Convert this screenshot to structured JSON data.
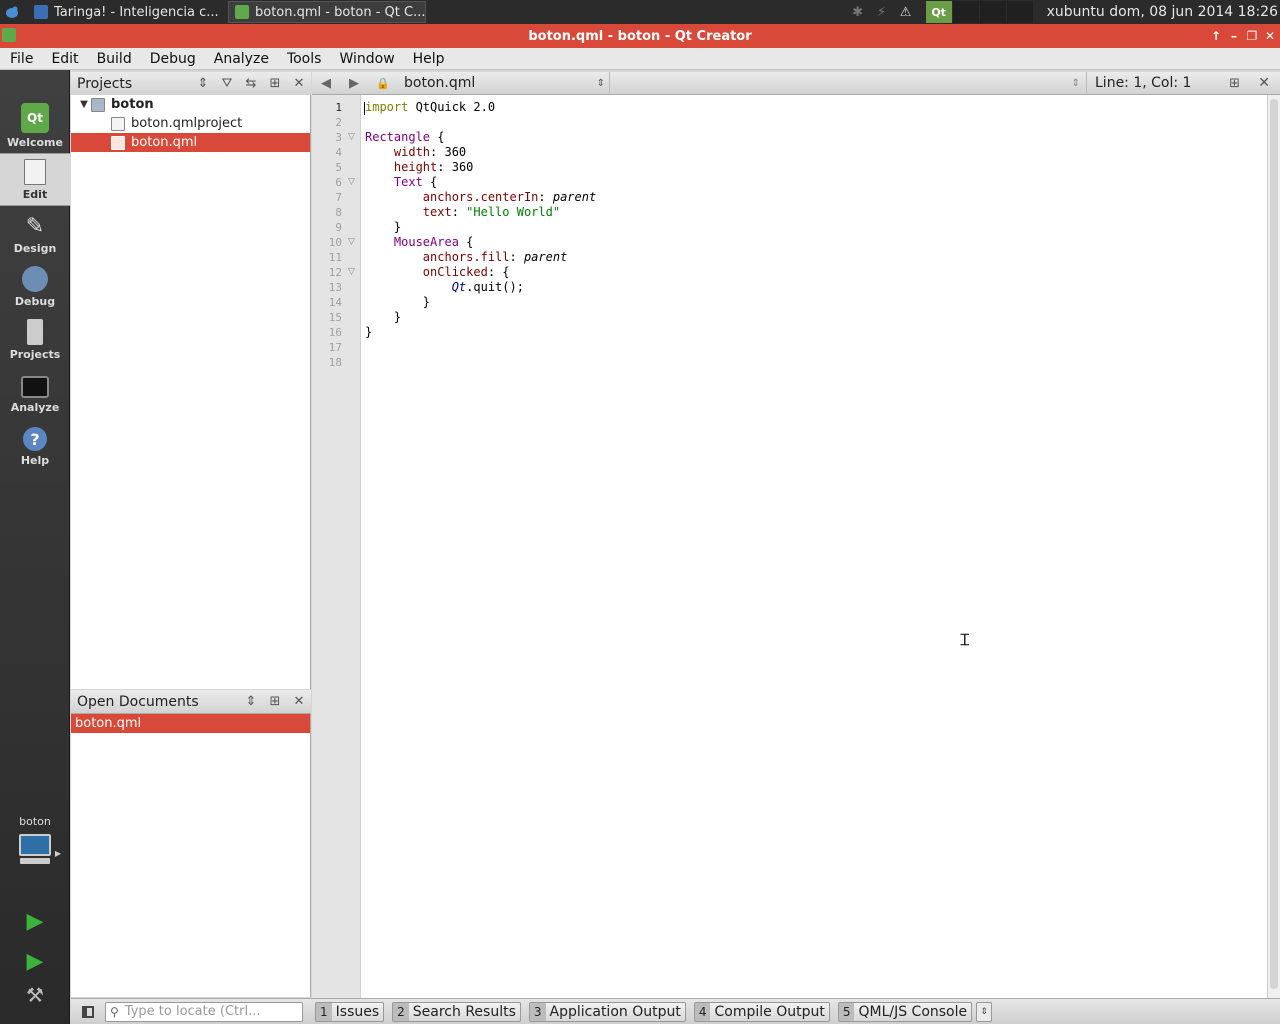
{
  "taskbar": {
    "tasks": [
      {
        "label": "Taringa! - Inteligencia c...",
        "icon": "browser-icon"
      },
      {
        "label": "boton.qml - boton - Qt C...",
        "icon": "qtcreator-icon"
      }
    ],
    "clock": "xubuntu  dom, 08 jun 2014 18:26"
  },
  "window": {
    "title": "boton.qml - boton - Qt Creator",
    "accent_color": "#d8493a"
  },
  "menu": [
    "File",
    "Edit",
    "Build",
    "Debug",
    "Analyze",
    "Tools",
    "Window",
    "Help"
  ],
  "modes": [
    {
      "label": "Welcome",
      "icon": "qt-logo-icon",
      "active": false
    },
    {
      "label": "Edit",
      "icon": "edit-document-icon",
      "active": true
    },
    {
      "label": "Design",
      "icon": "design-pencil-icon",
      "active": false
    },
    {
      "label": "Debug",
      "icon": "debug-bug-icon",
      "active": false
    },
    {
      "label": "Projects",
      "icon": "projects-wrench-icon",
      "active": false
    },
    {
      "label": "Analyze",
      "icon": "analyze-monitor-icon",
      "active": false
    },
    {
      "label": "Help",
      "icon": "help-question-icon",
      "active": false
    }
  ],
  "kit": {
    "label": "boton"
  },
  "projects_pane": {
    "title": "Projects",
    "tree": [
      {
        "label": "boton",
        "level": 0,
        "bold": true,
        "selected": false
      },
      {
        "label": "boton.qmlproject",
        "level": 1,
        "bold": false,
        "selected": false
      },
      {
        "label": "boton.qml",
        "level": 1,
        "bold": false,
        "selected": true
      }
    ]
  },
  "open_documents": {
    "title": "Open Documents",
    "items": [
      "boton.qml"
    ]
  },
  "editor": {
    "file": "boton.qml",
    "position": "Line: 1, Col: 1",
    "line_numbers": [
      "1",
      "2",
      "3",
      "4",
      "5",
      "6",
      "7",
      "8",
      "9",
      "10",
      "11",
      "12",
      "13",
      "14",
      "15",
      "16",
      "17",
      "18"
    ],
    "lines": [
      [
        {
          "t": "import",
          "c": "kw"
        },
        {
          "t": " QtQuick 2.0",
          "c": ""
        }
      ],
      [],
      [
        {
          "t": "Rectangle",
          "c": "ty"
        },
        {
          "t": " {",
          "c": ""
        }
      ],
      [
        {
          "t": "    ",
          "c": ""
        },
        {
          "t": "width",
          "c": "pr"
        },
        {
          "t": ": 360",
          "c": ""
        }
      ],
      [
        {
          "t": "    ",
          "c": ""
        },
        {
          "t": "height",
          "c": "pr"
        },
        {
          "t": ": 360",
          "c": ""
        }
      ],
      [
        {
          "t": "    ",
          "c": ""
        },
        {
          "t": "Text",
          "c": "ty"
        },
        {
          "t": " {",
          "c": ""
        }
      ],
      [
        {
          "t": "        ",
          "c": ""
        },
        {
          "t": "anchors.centerIn",
          "c": "pr"
        },
        {
          "t": ": ",
          "c": ""
        },
        {
          "t": "parent",
          "c": "it"
        }
      ],
      [
        {
          "t": "        ",
          "c": ""
        },
        {
          "t": "text",
          "c": "pr"
        },
        {
          "t": ": ",
          "c": ""
        },
        {
          "t": "\"Hello World\"",
          "c": "st"
        }
      ],
      [
        {
          "t": "    }",
          "c": ""
        }
      ],
      [
        {
          "t": "    ",
          "c": ""
        },
        {
          "t": "MouseArea",
          "c": "ty"
        },
        {
          "t": " {",
          "c": ""
        }
      ],
      [
        {
          "t": "        ",
          "c": ""
        },
        {
          "t": "anchors.fill",
          "c": "pr"
        },
        {
          "t": ": ",
          "c": ""
        },
        {
          "t": "parent",
          "c": "it"
        }
      ],
      [
        {
          "t": "        ",
          "c": ""
        },
        {
          "t": "onClicked",
          "c": "pr"
        },
        {
          "t": ": {",
          "c": ""
        }
      ],
      [
        {
          "t": "            ",
          "c": ""
        },
        {
          "t": "Qt",
          "c": "qt"
        },
        {
          "t": ".quit();",
          "c": ""
        }
      ],
      [
        {
          "t": "        }",
          "c": ""
        }
      ],
      [
        {
          "t": "    }",
          "c": ""
        }
      ],
      [
        {
          "t": "}",
          "c": ""
        }
      ],
      [],
      []
    ],
    "fold_markers": [
      3,
      6,
      10,
      12
    ]
  },
  "bottom": {
    "locator_placeholder": "Type to locate (Ctrl...",
    "output_tabs": [
      {
        "num": "1",
        "label": "Issues"
      },
      {
        "num": "2",
        "label": "Search Results"
      },
      {
        "num": "3",
        "label": "Application Output"
      },
      {
        "num": "4",
        "label": "Compile Output"
      },
      {
        "num": "5",
        "label": "QML/JS Console"
      }
    ]
  }
}
